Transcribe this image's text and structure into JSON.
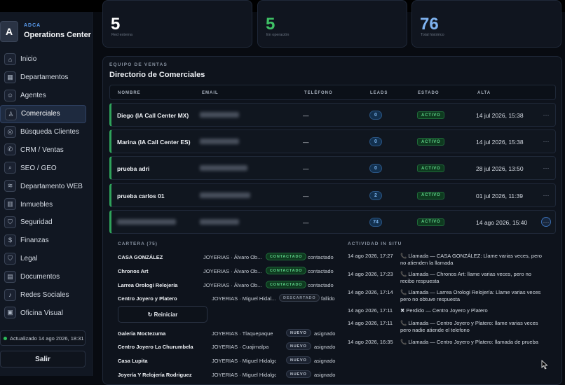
{
  "brand": {
    "small": "ADCA",
    "title": "Operations Center",
    "logo_letter": "A"
  },
  "nav": [
    {
      "label": "Inicio",
      "icon": "home-icon",
      "glyph": "⌂"
    },
    {
      "label": "Departamentos",
      "icon": "grid-icon",
      "glyph": "▦"
    },
    {
      "label": "Agentes",
      "icon": "bot-icon",
      "glyph": "☺"
    },
    {
      "label": "Comerciales",
      "icon": "users-icon",
      "glyph": "♙",
      "active": true
    },
    {
      "label": "Búsqueda Clientes",
      "icon": "target-icon",
      "glyph": "◎"
    },
    {
      "label": "CRM / Ventas",
      "icon": "phone-icon",
      "glyph": "✆"
    },
    {
      "label": "SEO / GEO",
      "icon": "search-icon",
      "glyph": "⌕"
    },
    {
      "label": "Departamento WEB",
      "icon": "layers-icon",
      "glyph": "≋"
    },
    {
      "label": "Inmuebles",
      "icon": "building-icon",
      "glyph": "▥"
    },
    {
      "label": "Seguridad",
      "icon": "shield-icon",
      "glyph": "⛉"
    },
    {
      "label": "Finanzas",
      "icon": "dollar-icon",
      "glyph": "$"
    },
    {
      "label": "Legal",
      "icon": "legal-shield-icon",
      "glyph": "⛉"
    },
    {
      "label": "Documentos",
      "icon": "document-icon",
      "glyph": "▤"
    },
    {
      "label": "Redes Sociales",
      "icon": "bell-icon",
      "glyph": "♪"
    },
    {
      "label": "Oficina Visual",
      "icon": "image-icon",
      "glyph": "▣"
    }
  ],
  "updated": "Actualizado 14 ago 2026, 18:31",
  "logout": "Salir",
  "kpis": [
    {
      "value": "5",
      "label": "Red externa",
      "color": "#ffffff"
    },
    {
      "value": "5",
      "label": "En operación",
      "color": "#3fc266"
    },
    {
      "value": "76",
      "label": "Total histórico",
      "color": "#7fb3f0"
    }
  ],
  "section": {
    "small": "EQUIPO DE VENTAS",
    "title": "Directorio de Comerciales"
  },
  "columns": {
    "nombre": "NOMBRE",
    "email": "EMAIL",
    "telefono": "TELÉFONO",
    "leads": "LEADS",
    "estado": "ESTADO",
    "alta": "ALTA"
  },
  "rows": [
    {
      "name": "Diego (IA Call Center MX)",
      "phone": "—",
      "leads": "0",
      "estado": "ACTIVO",
      "alta": "14 jul 2026, 15:38"
    },
    {
      "name": "Marina (IA Call Center ES)",
      "phone": "—",
      "leads": "0",
      "estado": "ACTIVO",
      "alta": "14 jul 2026, 15:38"
    },
    {
      "name": "prueba adri",
      "phone": "—",
      "leads": "0",
      "estado": "ACTIVO",
      "alta": "28 jul 2026, 13:50"
    },
    {
      "name": "prueba carlos 01",
      "phone": "—",
      "leads": "2",
      "estado": "ACTIVO",
      "alta": "01 jul 2026, 11:39"
    },
    {
      "name": "",
      "phone": "—",
      "leads": "74",
      "estado": "ACTIVO",
      "alta": "14 ago 2026, 15:40"
    }
  ],
  "more_glyph": "···",
  "cartera": {
    "title": "CARTERA (75)",
    "reset_label": "↻ Reiniciar",
    "items": [
      {
        "name": "CASA GONZÁLEZ",
        "group": "JOYERIAS · Álvaro Ob...",
        "badge": "CONTACTADO",
        "status": "contactado"
      },
      {
        "name": "Chronos Art",
        "group": "JOYERIAS · Álvaro Ob...",
        "badge": "CONTACTADO",
        "status": "contactado"
      },
      {
        "name": "Larrea Orologi Relojería",
        "group": "JOYERIAS · Álvaro Ob...",
        "badge": "CONTACTADO",
        "status": "contactado"
      },
      {
        "name": "Centro Joyero y Platero",
        "group": "JOYERIAS · Miguel Hidal...",
        "badge": "DESCARTADO",
        "status": "fallido"
      },
      {
        "name": "Galeria Moctezuma",
        "group": "JOYERIAS · Tlaquepaque",
        "badge": "NUEVO",
        "status": "asignado"
      },
      {
        "name": "Centro Joyero La Churumbela",
        "group": "JOYERIAS · Cuajimalpa",
        "badge": "NUEVO",
        "status": "asignado"
      },
      {
        "name": "Casa Lupita",
        "group": "JOYERIAS · Miguel Hidalgo",
        "badge": "NUEVO",
        "status": "asignado"
      },
      {
        "name": "Joyería Y Relojería Rodriguez",
        "group": "JOYERIAS · Miguel Hidalgo",
        "badge": "NUEVO",
        "status": "asignado"
      }
    ]
  },
  "actividad": {
    "title": "ACTIVIDAD IN SITU",
    "items": [
      {
        "date": "14 ago 2026, 17:27",
        "text": "📞 Llamada — CASA GONZÁLEZ: Llame varias veces, pero no atienden la llamada"
      },
      {
        "date": "14 ago 2026, 17:23",
        "text": "📞 Llamada — Chronos Art: llame varias veces, pero no recibo respuesta"
      },
      {
        "date": "14 ago 2026, 17:14",
        "text": "📞 Llamada — Larrea Orologi Relojería: Llame varias veces pero no obtuve respuesta"
      },
      {
        "date": "14 ago 2026, 17:11",
        "text": "✖ Perdido — Centro Joyero y Platero"
      },
      {
        "date": "14 ago 2026, 17:11",
        "text": "📞 Llamada — Centro Joyero y Platero: llame varias veces pero nadie atiende el telefono"
      },
      {
        "date": "14 ago 2026, 16:35",
        "text": "📞 Llamada — Centro Joyero y Platero: llamada de prueba"
      }
    ]
  }
}
